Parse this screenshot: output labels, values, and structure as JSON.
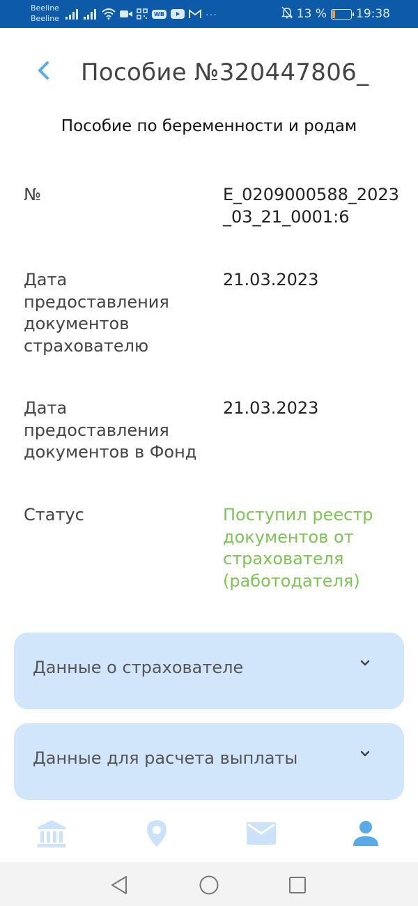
{
  "status_bar": {
    "carrier1": "Beeline",
    "carrier2": "Beeline",
    "wb_badge": "WB",
    "more": "···",
    "battery_percent": "13 %",
    "time": "19:38",
    "icons": [
      "signal-icon",
      "signal-icon",
      "wifi-icon",
      "video-icon",
      "qr-icon",
      "wb-icon",
      "youtube-icon",
      "gmail-icon",
      "bell-off-icon",
      "battery-icon"
    ]
  },
  "header": {
    "title": "Пособие №320447806_",
    "subtitle": "Пособие по беременности и родам"
  },
  "details": [
    {
      "label": "№",
      "value": "E_0209000588_2023_03_21_0001:6"
    },
    {
      "label": "Дата предоставления документов страхователю",
      "value": "21.03.2023"
    },
    {
      "label": "Дата предоставления документов в Фонд",
      "value": "21.03.2023"
    },
    {
      "label": "Статус",
      "value": "Поступил реестр документов от страхователя (работодателя)"
    }
  ],
  "accordions": [
    {
      "label": "Данные о страхователе"
    },
    {
      "label": "Данные для расчета выплаты"
    }
  ],
  "tabs": [
    "bank-icon",
    "location-icon",
    "mail-icon",
    "profile-icon"
  ],
  "colors": {
    "status_bar": "#0d5aa8",
    "accent": "#5aaae8",
    "status_text": "#7bc653",
    "accordion_bg": "#d1e6fa",
    "tab_inactive": "#cbe3f8"
  }
}
